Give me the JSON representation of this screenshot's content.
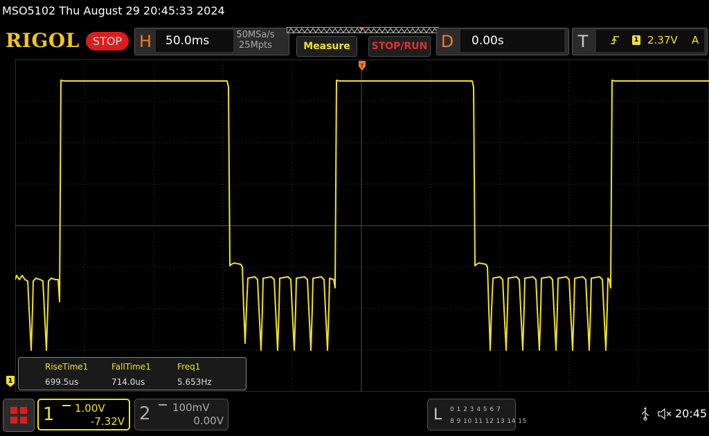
{
  "titlebar": {
    "text": "MSO5102  Thu August 29 20:45:33 2024"
  },
  "header": {
    "logo": "RIGOL",
    "run_state": "STOP"
  },
  "horizontal": {
    "letter": "H",
    "timebase": "50.0ms",
    "sample_rate": "50MSa/s",
    "memory_depth": "25Mpts"
  },
  "buttons": {
    "measure": "Measure",
    "stop_run": "STOP/RUN"
  },
  "delay": {
    "letter": "D",
    "value": "0.00s"
  },
  "trigger": {
    "letter": "T",
    "source": "1",
    "level": "2.37V",
    "mode": "A",
    "edge_icon": "rising-edge-icon"
  },
  "measurements": [
    {
      "name": "RiseTime1",
      "value": "699.5us"
    },
    {
      "name": "FallTime1",
      "value": "714.0us"
    },
    {
      "name": "Freq1",
      "value": "5.653Hz"
    }
  ],
  "channel_marker": "1",
  "channel1": {
    "number": "1",
    "scale": "1.00V",
    "offset": "-7.32V"
  },
  "channel2": {
    "number": "2",
    "scale": "100mV",
    "offset": "0.00V"
  },
  "logic": {
    "letter": "L",
    "row1": "0 1 2 3   4 5 6 7",
    "row2": "8  9 10 11  12 13 14 15"
  },
  "status": {
    "time": "20:45",
    "usb_icon": "usb-icon",
    "sound_icon": "mute-icon"
  },
  "colors": {
    "ch1": "#f2e12b",
    "accent": "#f47b1c",
    "stop": "#d81e1e"
  }
}
